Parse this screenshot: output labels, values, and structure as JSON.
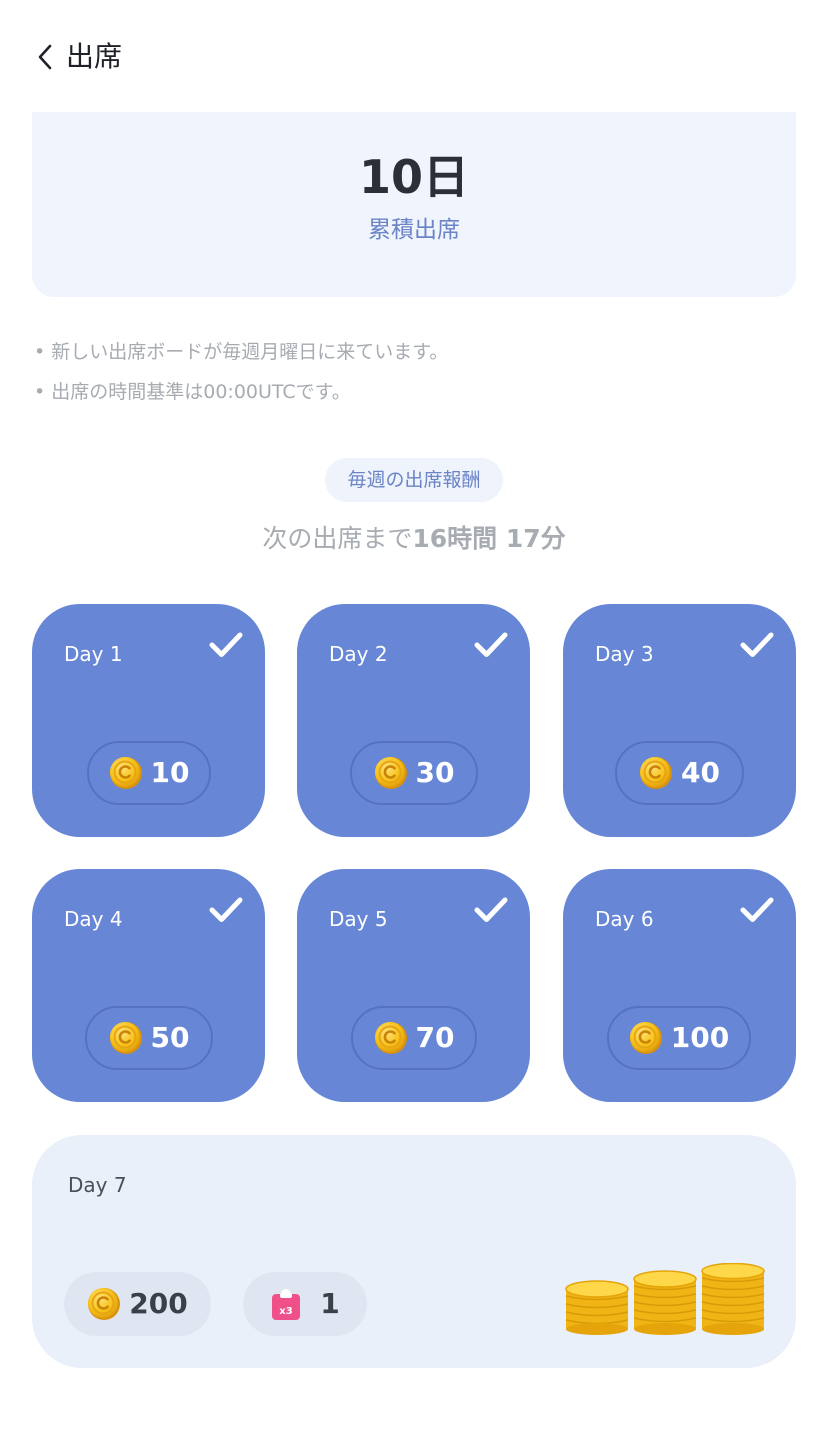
{
  "header": {
    "title": "出席"
  },
  "summary": {
    "days": "10日",
    "label": "累積出席"
  },
  "notes": [
    "• 新しい出席ボードが毎週月曜日に来ています。",
    "• 出席の時間基準は00:00UTCです。"
  ],
  "weekly": {
    "title": "毎週の出席報酬",
    "countdown_prefix": "次の出席まで",
    "countdown_time": "16時間 17分"
  },
  "days": [
    {
      "label": "Day 1",
      "amount": "10",
      "checked": true
    },
    {
      "label": "Day 2",
      "amount": "30",
      "checked": true
    },
    {
      "label": "Day 3",
      "amount": "40",
      "checked": true
    },
    {
      "label": "Day 4",
      "amount": "50",
      "checked": true
    },
    {
      "label": "Day 5",
      "amount": "70",
      "checked": true
    },
    {
      "label": "Day 6",
      "amount": "100",
      "checked": true
    }
  ],
  "bonus": {
    "label": "Day 7",
    "coin_amount": "200",
    "ticket_amount": "1",
    "ticket_badge": "x3"
  },
  "colors": {
    "card": "#6787d6",
    "accent": "#6b84c6",
    "coin": "#f7c21b",
    "ticket": "#f0508a"
  }
}
